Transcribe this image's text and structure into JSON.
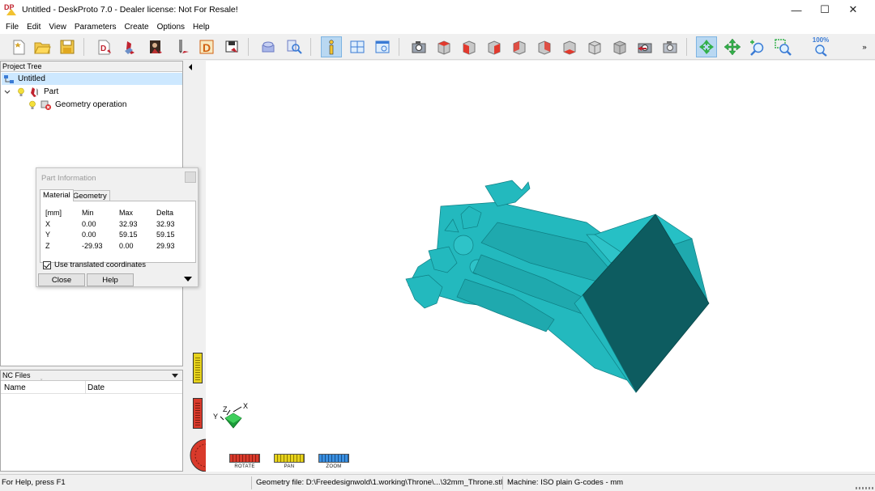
{
  "window": {
    "title": "Untitled - DeskProto 7.0 - Dealer license: Not For Resale!",
    "controls": {
      "minimize": "—",
      "maximize": "☐",
      "close": "✕"
    }
  },
  "menu": [
    "File",
    "Edit",
    "View",
    "Parameters",
    "Create",
    "Options",
    "Help"
  ],
  "toolbar": {
    "zoom_level": "100%",
    "overflow": "»",
    "icons": [
      "new-file-icon",
      "open-folder-icon",
      "save-icon",
      "wizard-icon",
      "import-icon",
      "photo-icon",
      "tool-icon",
      "d-parameter-icon",
      "export-icon",
      "machine-icon",
      "view-icon",
      "info-icon",
      "layout-icon",
      "window-icon",
      "camera-icon",
      "view-top-icon",
      "view-front-icon",
      "view-right-icon",
      "view-back-icon",
      "view-left-icon",
      "view-bottom-icon",
      "view-iso-icon",
      "view-iso2-icon",
      "reset-view-icon",
      "screenshot-icon",
      "rotate-icon",
      "pan-icon",
      "zoom-in-icon",
      "zoom-window-icon",
      "zoom-100-icon"
    ],
    "active_icon": "info-icon"
  },
  "project_tree": {
    "header": "Project Tree",
    "root": "Untitled",
    "part": "Part",
    "operation": "Geometry operation"
  },
  "part_info": {
    "title": "Part Information",
    "tabs": [
      "Material",
      "Geometry"
    ],
    "active_tab": "Material",
    "columns": [
      "[mm]",
      "Min",
      "Max",
      "Delta"
    ],
    "rows": [
      [
        "X",
        "0.00",
        "32.93",
        "32.93"
      ],
      [
        "Y",
        "0.00",
        "59.15",
        "59.15"
      ],
      [
        "Z",
        "-29.93",
        "0.00",
        "29.93"
      ]
    ],
    "checkbox_label": "Use translated coordinates",
    "checkbox_checked": true,
    "close_button": "Close",
    "help_button": "Help"
  },
  "nc_files": {
    "header": "NC Files",
    "columns": [
      "Name",
      "Date"
    ]
  },
  "axes": {
    "x": "X",
    "y": "Y",
    "z": "Z"
  },
  "nav_controls": [
    {
      "label": "ROTATE",
      "color": "#d93a2b"
    },
    {
      "label": "PAN",
      "color": "#e6d21c"
    },
    {
      "label": "ZOOM",
      "color": "#3a8fe0"
    }
  ],
  "model": {
    "color": "#23b9be",
    "shade": "#0d5c60"
  },
  "statusbar": {
    "help": "For Help, press F1",
    "geometry_file": "Geometry file: D:\\Freedesignwold\\1.working\\Throne\\...\\32mm_Throne.stl",
    "machine": "Machine: ISO plain G-codes - mm"
  }
}
